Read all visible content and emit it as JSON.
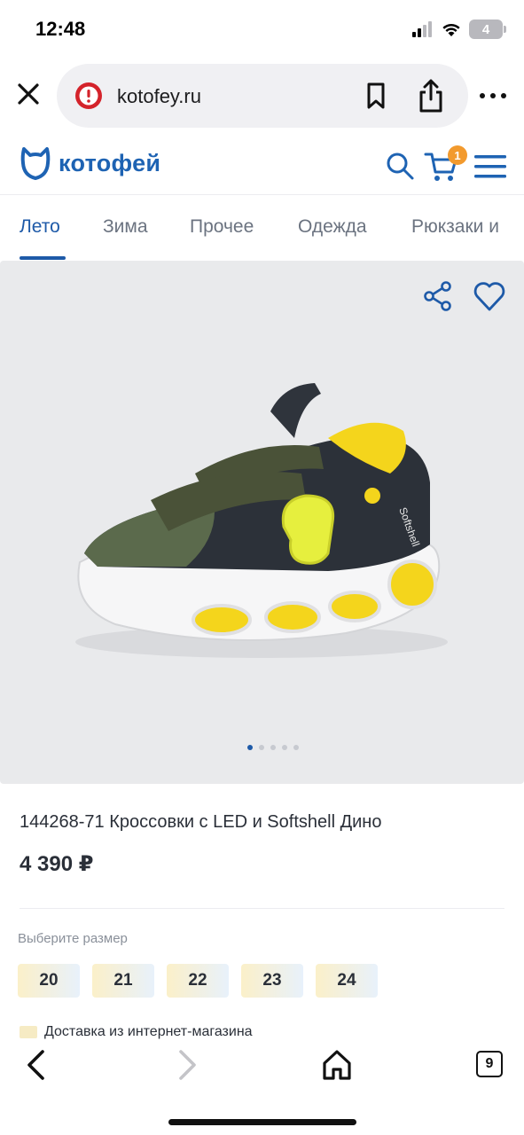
{
  "status_bar": {
    "time": "12:48",
    "battery_level": "4",
    "icons": [
      "signal-icon",
      "wifi-icon",
      "battery-icon"
    ]
  },
  "browser": {
    "url": "kotofey.ru",
    "icons": [
      "close-icon",
      "alert-icon",
      "bookmark-icon",
      "share-icon",
      "more-icon"
    ]
  },
  "site_header": {
    "logo_text": "котофей",
    "cart_count": "1",
    "brand_color": "#1e63b3",
    "badge_color": "#f29a2e"
  },
  "tabs": [
    {
      "label": "Лето",
      "active": true
    },
    {
      "label": "Зима",
      "active": false
    },
    {
      "label": "Прочее",
      "active": false
    },
    {
      "label": "Одежда",
      "active": false
    },
    {
      "label": "Рюкзаки и",
      "active": false
    }
  ],
  "product": {
    "title": "144268-71 Кроссовки с LED и Softshell Дино",
    "price": "4 390 ₽",
    "image_slide_count": 5,
    "image_active_slide": 1,
    "size_label": "Выберите размер",
    "sizes": [
      "20",
      "21",
      "22",
      "23",
      "24"
    ],
    "delivery_text": "Доставка из интернет-магазина",
    "shoe_brand_text": "Softshell"
  },
  "toolbar": {
    "tab_count": "9",
    "icons": [
      "back-icon",
      "forward-icon",
      "home-icon",
      "tabs-icon"
    ]
  }
}
